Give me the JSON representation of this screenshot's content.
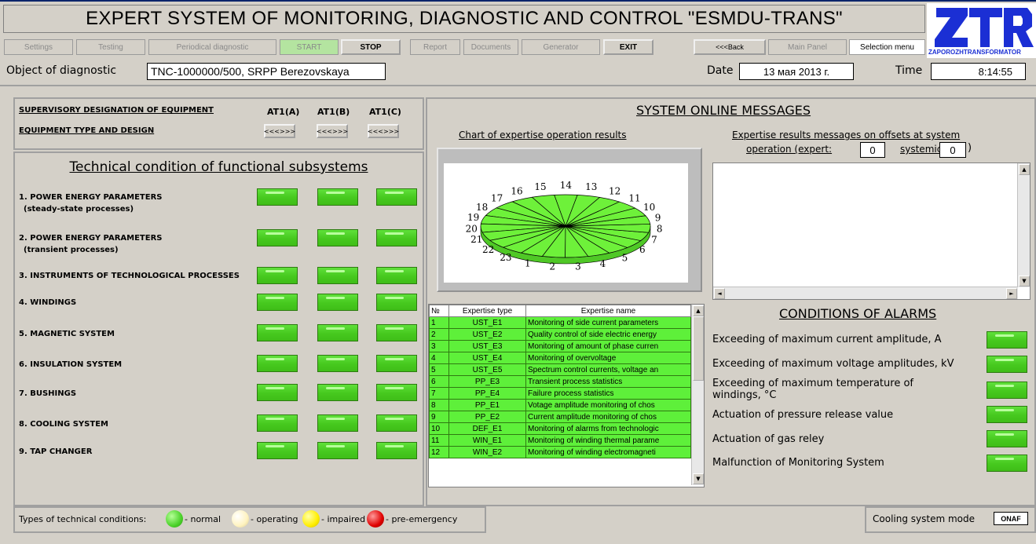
{
  "title": "EXPERT SYSTEM OF MONITORING, DIAGNOSTIC AND CONTROL \"ESMDU-TRANS\"",
  "logo": {
    "letters": "ZTR",
    "caption": "ZAPOROZHTRANSFORMATOR"
  },
  "toolbar": {
    "settings": "Settings",
    "testing": "Testing",
    "periodical": "Periodical diagnostic",
    "start": "START",
    "stop": "STOP",
    "report": "Report",
    "documents": "Documents",
    "generator": "Generator",
    "exit": "EXIT",
    "back": "<<<Back",
    "main_panel": "Main Panel",
    "selection_menu": "Selection menu"
  },
  "object": {
    "label": "Object of diagnostic",
    "value": "TNC-1000000/500, SRPP Berezovskaya"
  },
  "date": {
    "label": "Date",
    "value": "13 мая 2013 г."
  },
  "time": {
    "label": "Time",
    "value": "8:14:55"
  },
  "equipment": {
    "supervisory_label": "SUPERVISORY DESIGNATION OF EQUIPMENT",
    "type_label": "EQUIPMENT TYPE AND DESIGN",
    "phases": [
      "AT1(A)",
      "AT1(B)",
      "AT1(C)"
    ],
    "type_buttons": [
      "<<<>>>",
      "<<<>>>",
      "<<<>>>"
    ]
  },
  "subsystems": {
    "title": "Technical condition of functional subsystems",
    "items": [
      {
        "name": "1. POWER ENERGY PARAMETERS",
        "sub": "(steady-state processes)"
      },
      {
        "name": "2. POWER ENERGY PARAMETERS",
        "sub": "(transient processes)"
      },
      {
        "name": "3. INSTRUMENTS OF TECHNOLOGICAL PROCESSES",
        "sub": ""
      },
      {
        "name": "4. WINDINGS",
        "sub": ""
      },
      {
        "name": "5. MAGNETIC SYSTEM",
        "sub": ""
      },
      {
        "name": "6. INSULATION SYSTEM",
        "sub": ""
      },
      {
        "name": "7.  BUSHINGS",
        "sub": ""
      },
      {
        "name": "8. COOLING SYSTEM",
        "sub": ""
      },
      {
        "name": "9. TAP CHANGER",
        "sub": ""
      }
    ],
    "indicator_color": "#46c91e"
  },
  "messages": {
    "title": "SYSTEM ONLINE MESSAGES",
    "chart_title": "Chart of expertise operation results",
    "results_title_1": "Expertise results messages on offsets at system",
    "results_title_2": "operation (expert:",
    "expert_count": "0",
    "systemic_label": "systemic:",
    "systemic_count": "0",
    "close_paren": ")"
  },
  "chart_data": {
    "type": "pie",
    "categories": [
      "1",
      "2",
      "3",
      "4",
      "5",
      "6",
      "7",
      "8",
      "9",
      "10",
      "11",
      "12",
      "13",
      "14",
      "15",
      "16",
      "17",
      "18",
      "19",
      "20",
      "21",
      "22",
      "23"
    ],
    "values": [
      1,
      1,
      1,
      1,
      1,
      1,
      1,
      1,
      1,
      1,
      1,
      1,
      1,
      1,
      1,
      1,
      1,
      1,
      1,
      1,
      1,
      1,
      1
    ],
    "color": "#6ef13a"
  },
  "expertise_table": {
    "headers": [
      "№",
      "Expertise type",
      "Expertise name"
    ],
    "rows": [
      [
        "1",
        "UST_E1",
        "Monitoring of side current parameters"
      ],
      [
        "2",
        "UST_E2",
        "Quality control of side electric energy"
      ],
      [
        "3",
        "UST_E3",
        "Monitoring of amount of phase curren"
      ],
      [
        "4",
        "UST_E4",
        "Monitoring of overvoltage"
      ],
      [
        "5",
        "UST_E5",
        "Spectrum control currents, voltage an"
      ],
      [
        "6",
        "PP_E3",
        "Transient process statistics"
      ],
      [
        "7",
        "PP_E4",
        "Failure process statistics"
      ],
      [
        "8",
        "PP_E1",
        "Votage amplitude monitoring of chos"
      ],
      [
        "9",
        "PP_E2",
        "Current amplitude monitoring of chos"
      ],
      [
        "10",
        "DEF_E1",
        "Monitoring of alarms from technologic"
      ],
      [
        "11",
        "WIN_E1",
        "Monitoring of winding thermal parame"
      ],
      [
        "12",
        "WIN_E2",
        "Monitoring of winding electromagneti"
      ]
    ]
  },
  "alarms": {
    "title": "CONDITIONS OF ALARMS",
    "items": [
      "Exceeding of maximum current amplitude, A",
      "Exceeding of maximum voltage amplitudes, kV",
      "Exceeding of maximum temperature of windings, °C",
      "Actuation of pressure release value",
      "Actuation of gas reley",
      "Malfunction of Monitoring System"
    ]
  },
  "legend": {
    "label": "Types of technical conditions:",
    "items": [
      {
        "text": "- normal",
        "color": "#4bd22a"
      },
      {
        "text": "- operating",
        "color": "#fff3c0"
      },
      {
        "text": "- impaired",
        "color": "#ffee00"
      },
      {
        "text": "- pre-emergency",
        "color": "#e00000"
      }
    ]
  },
  "cooling": {
    "label": "Cooling system mode",
    "value": "ONAF"
  }
}
